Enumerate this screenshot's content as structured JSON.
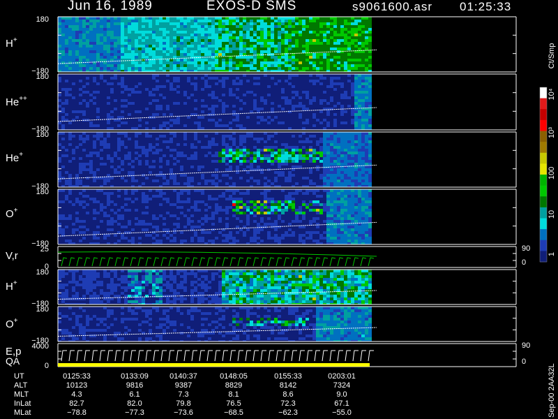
{
  "header": {
    "date": "Jun 16, 1989",
    "instrument": "EXOS-D SMS",
    "file": "s9061600.asr",
    "time": "01:25:33"
  },
  "panels": [
    {
      "id": "h-plus",
      "label_base": "H",
      "label_sup": "+",
      "y_top": "180",
      "y_bot": "−180"
    },
    {
      "id": "he-pp",
      "label_base": "He",
      "label_sup": "++",
      "y_top": "180",
      "y_bot": "−180"
    },
    {
      "id": "he-plus",
      "label_base": "He",
      "label_sup": "+",
      "y_top": "180",
      "y_bot": "−180"
    },
    {
      "id": "o-plus",
      "label_base": "O",
      "label_sup": "+",
      "y_top": "180",
      "y_bot": "−180"
    },
    {
      "id": "vr",
      "label_base": "V,r",
      "label_sup": "",
      "y_top": "25",
      "y_bot": "0",
      "right_top": "90",
      "right_bot": "0"
    },
    {
      "id": "h-plus-2",
      "label_base": "H",
      "label_sup": "+",
      "y_top": "180",
      "y_bot": "−180"
    },
    {
      "id": "o-plus-2",
      "label_base": "O",
      "label_sup": "+",
      "y_top": "180",
      "y_bot": "−180"
    },
    {
      "id": "ep",
      "label_base": "E,p",
      "label_sup": "",
      "y_top": "4000",
      "y_bot": "0",
      "right_top": "90",
      "right_bot": "0",
      "label2": "QA"
    }
  ],
  "colorbar": {
    "title": "Ct/Smp",
    "ticks": [
      "10⁴",
      "10³",
      "100",
      "10",
      "1"
    ],
    "colors": [
      "#ffffff",
      "#e11a1a",
      "#c40000",
      "#ff0000",
      "#8c6000",
      "#a07a00",
      "#c8c800",
      "#e6e600",
      "#00b400",
      "#00c800",
      "#007800",
      "#00a0a0",
      "#00dcdc",
      "#0070c0",
      "#1e3cb4",
      "#101e78"
    ]
  },
  "time_axis": {
    "rows": [
      {
        "label": "UT",
        "values": [
          "0125:33",
          "0133:09",
          "0140:37",
          "0148:05",
          "0155:33",
          "0203:01"
        ]
      },
      {
        "label": "ALT",
        "values": [
          "10123",
          "9816",
          "9387",
          "8829",
          "8142",
          "7324"
        ]
      },
      {
        "label": "MLT",
        "values": [
          "4.3",
          "6.1",
          "7.3",
          "8.1",
          "8.6",
          "9.0"
        ]
      },
      {
        "label": "InLat",
        "values": [
          "82.7",
          "82.0",
          "79.8",
          "76.5",
          "72.3",
          "67.1"
        ]
      },
      {
        "label": "MLat",
        "values": [
          "−78.8",
          "−77.3",
          "−73.6",
          "−68.5",
          "−62.3",
          "−55.0"
        ]
      }
    ]
  },
  "footer_right": "Sep-00  2AA32L",
  "chart_data": {
    "type": "heatmap",
    "title": "Jun 16, 1989   EXOS-D SMS",
    "x_ut": [
      "0125:33",
      "0133:09",
      "0140:37",
      "0148:05",
      "0155:33",
      "0203:01"
    ],
    "panels": [
      "H+",
      "He++",
      "He+",
      "O+",
      "V,r",
      "H+",
      "O+",
      "E,p / QA"
    ],
    "pitch_angle_range": [
      -180,
      180
    ],
    "colorbar_unit": "Ct/Smp",
    "colorbar_scale": "log",
    "colorbar_range": [
      1,
      10000
    ]
  }
}
